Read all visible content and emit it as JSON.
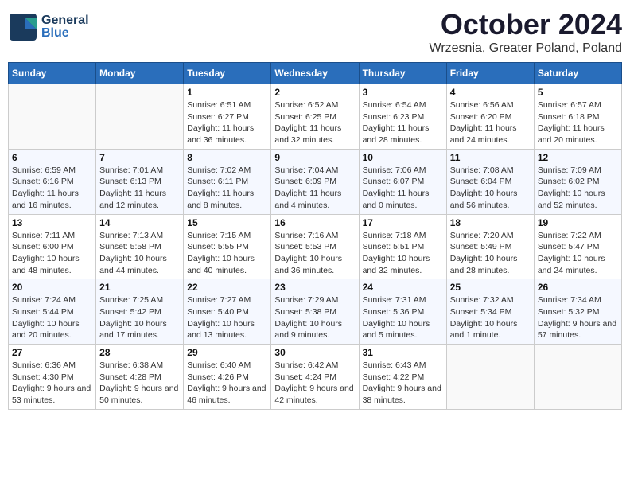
{
  "header": {
    "logo_general": "General",
    "logo_blue": "Blue",
    "month_title": "October 2024",
    "location": "Wrzesnia, Greater Poland, Poland"
  },
  "days_of_week": [
    "Sunday",
    "Monday",
    "Tuesday",
    "Wednesday",
    "Thursday",
    "Friday",
    "Saturday"
  ],
  "weeks": [
    [
      {
        "day": "",
        "info": ""
      },
      {
        "day": "",
        "info": ""
      },
      {
        "day": "1",
        "sunrise": "6:51 AM",
        "sunset": "6:27 PM",
        "daylight": "11 hours and 36 minutes."
      },
      {
        "day": "2",
        "sunrise": "6:52 AM",
        "sunset": "6:25 PM",
        "daylight": "11 hours and 32 minutes."
      },
      {
        "day": "3",
        "sunrise": "6:54 AM",
        "sunset": "6:23 PM",
        "daylight": "11 hours and 28 minutes."
      },
      {
        "day": "4",
        "sunrise": "6:56 AM",
        "sunset": "6:20 PM",
        "daylight": "11 hours and 24 minutes."
      },
      {
        "day": "5",
        "sunrise": "6:57 AM",
        "sunset": "6:18 PM",
        "daylight": "11 hours and 20 minutes."
      }
    ],
    [
      {
        "day": "6",
        "sunrise": "6:59 AM",
        "sunset": "6:16 PM",
        "daylight": "11 hours and 16 minutes."
      },
      {
        "day": "7",
        "sunrise": "7:01 AM",
        "sunset": "6:13 PM",
        "daylight": "11 hours and 12 minutes."
      },
      {
        "day": "8",
        "sunrise": "7:02 AM",
        "sunset": "6:11 PM",
        "daylight": "11 hours and 8 minutes."
      },
      {
        "day": "9",
        "sunrise": "7:04 AM",
        "sunset": "6:09 PM",
        "daylight": "11 hours and 4 minutes."
      },
      {
        "day": "10",
        "sunrise": "7:06 AM",
        "sunset": "6:07 PM",
        "daylight": "11 hours and 0 minutes."
      },
      {
        "day": "11",
        "sunrise": "7:08 AM",
        "sunset": "6:04 PM",
        "daylight": "10 hours and 56 minutes."
      },
      {
        "day": "12",
        "sunrise": "7:09 AM",
        "sunset": "6:02 PM",
        "daylight": "10 hours and 52 minutes."
      }
    ],
    [
      {
        "day": "13",
        "sunrise": "7:11 AM",
        "sunset": "6:00 PM",
        "daylight": "10 hours and 48 minutes."
      },
      {
        "day": "14",
        "sunrise": "7:13 AM",
        "sunset": "5:58 PM",
        "daylight": "10 hours and 44 minutes."
      },
      {
        "day": "15",
        "sunrise": "7:15 AM",
        "sunset": "5:55 PM",
        "daylight": "10 hours and 40 minutes."
      },
      {
        "day": "16",
        "sunrise": "7:16 AM",
        "sunset": "5:53 PM",
        "daylight": "10 hours and 36 minutes."
      },
      {
        "day": "17",
        "sunrise": "7:18 AM",
        "sunset": "5:51 PM",
        "daylight": "10 hours and 32 minutes."
      },
      {
        "day": "18",
        "sunrise": "7:20 AM",
        "sunset": "5:49 PM",
        "daylight": "10 hours and 28 minutes."
      },
      {
        "day": "19",
        "sunrise": "7:22 AM",
        "sunset": "5:47 PM",
        "daylight": "10 hours and 24 minutes."
      }
    ],
    [
      {
        "day": "20",
        "sunrise": "7:24 AM",
        "sunset": "5:44 PM",
        "daylight": "10 hours and 20 minutes."
      },
      {
        "day": "21",
        "sunrise": "7:25 AM",
        "sunset": "5:42 PM",
        "daylight": "10 hours and 17 minutes."
      },
      {
        "day": "22",
        "sunrise": "7:27 AM",
        "sunset": "5:40 PM",
        "daylight": "10 hours and 13 minutes."
      },
      {
        "day": "23",
        "sunrise": "7:29 AM",
        "sunset": "5:38 PM",
        "daylight": "10 hours and 9 minutes."
      },
      {
        "day": "24",
        "sunrise": "7:31 AM",
        "sunset": "5:36 PM",
        "daylight": "10 hours and 5 minutes."
      },
      {
        "day": "25",
        "sunrise": "7:32 AM",
        "sunset": "5:34 PM",
        "daylight": "10 hours and 1 minute."
      },
      {
        "day": "26",
        "sunrise": "7:34 AM",
        "sunset": "5:32 PM",
        "daylight": "9 hours and 57 minutes."
      }
    ],
    [
      {
        "day": "27",
        "sunrise": "6:36 AM",
        "sunset": "4:30 PM",
        "daylight": "9 hours and 53 minutes."
      },
      {
        "day": "28",
        "sunrise": "6:38 AM",
        "sunset": "4:28 PM",
        "daylight": "9 hours and 50 minutes."
      },
      {
        "day": "29",
        "sunrise": "6:40 AM",
        "sunset": "4:26 PM",
        "daylight": "9 hours and 46 minutes."
      },
      {
        "day": "30",
        "sunrise": "6:42 AM",
        "sunset": "4:24 PM",
        "daylight": "9 hours and 42 minutes."
      },
      {
        "day": "31",
        "sunrise": "6:43 AM",
        "sunset": "4:22 PM",
        "daylight": "9 hours and 38 minutes."
      },
      {
        "day": "",
        "info": ""
      },
      {
        "day": "",
        "info": ""
      }
    ]
  ],
  "labels": {
    "sunrise_prefix": "Sunrise: ",
    "sunset_prefix": "Sunset: ",
    "daylight_prefix": "Daylight: "
  }
}
